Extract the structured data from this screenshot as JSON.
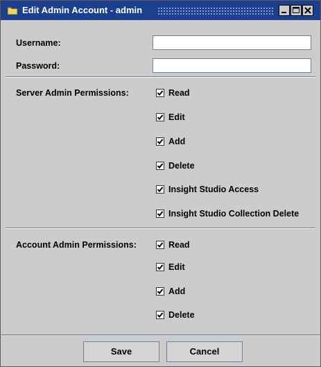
{
  "window": {
    "title": "Edit Admin Account - admin",
    "controls": [
      "minimize",
      "maximize",
      "close"
    ]
  },
  "form": {
    "username_label": "Username:",
    "username_value": "",
    "password_label": "Password:",
    "password_value": ""
  },
  "server_permissions": {
    "label": "Server Admin Permissions:",
    "items": [
      {
        "label": "Read",
        "checked": true
      },
      {
        "label": "Edit",
        "checked": true
      },
      {
        "label": "Add",
        "checked": true
      },
      {
        "label": "Delete",
        "checked": true
      },
      {
        "label": "Insight Studio Access",
        "checked": true
      },
      {
        "label": "Insight Studio Collection Delete",
        "checked": true
      }
    ]
  },
  "account_permissions": {
    "label": "Account Admin Permissions:",
    "items": [
      {
        "label": "Read",
        "checked": true
      },
      {
        "label": "Edit",
        "checked": true
      },
      {
        "label": "Add",
        "checked": true
      },
      {
        "label": "Delete",
        "checked": true
      }
    ]
  },
  "buttons": {
    "save": "Save",
    "cancel": "Cancel"
  }
}
